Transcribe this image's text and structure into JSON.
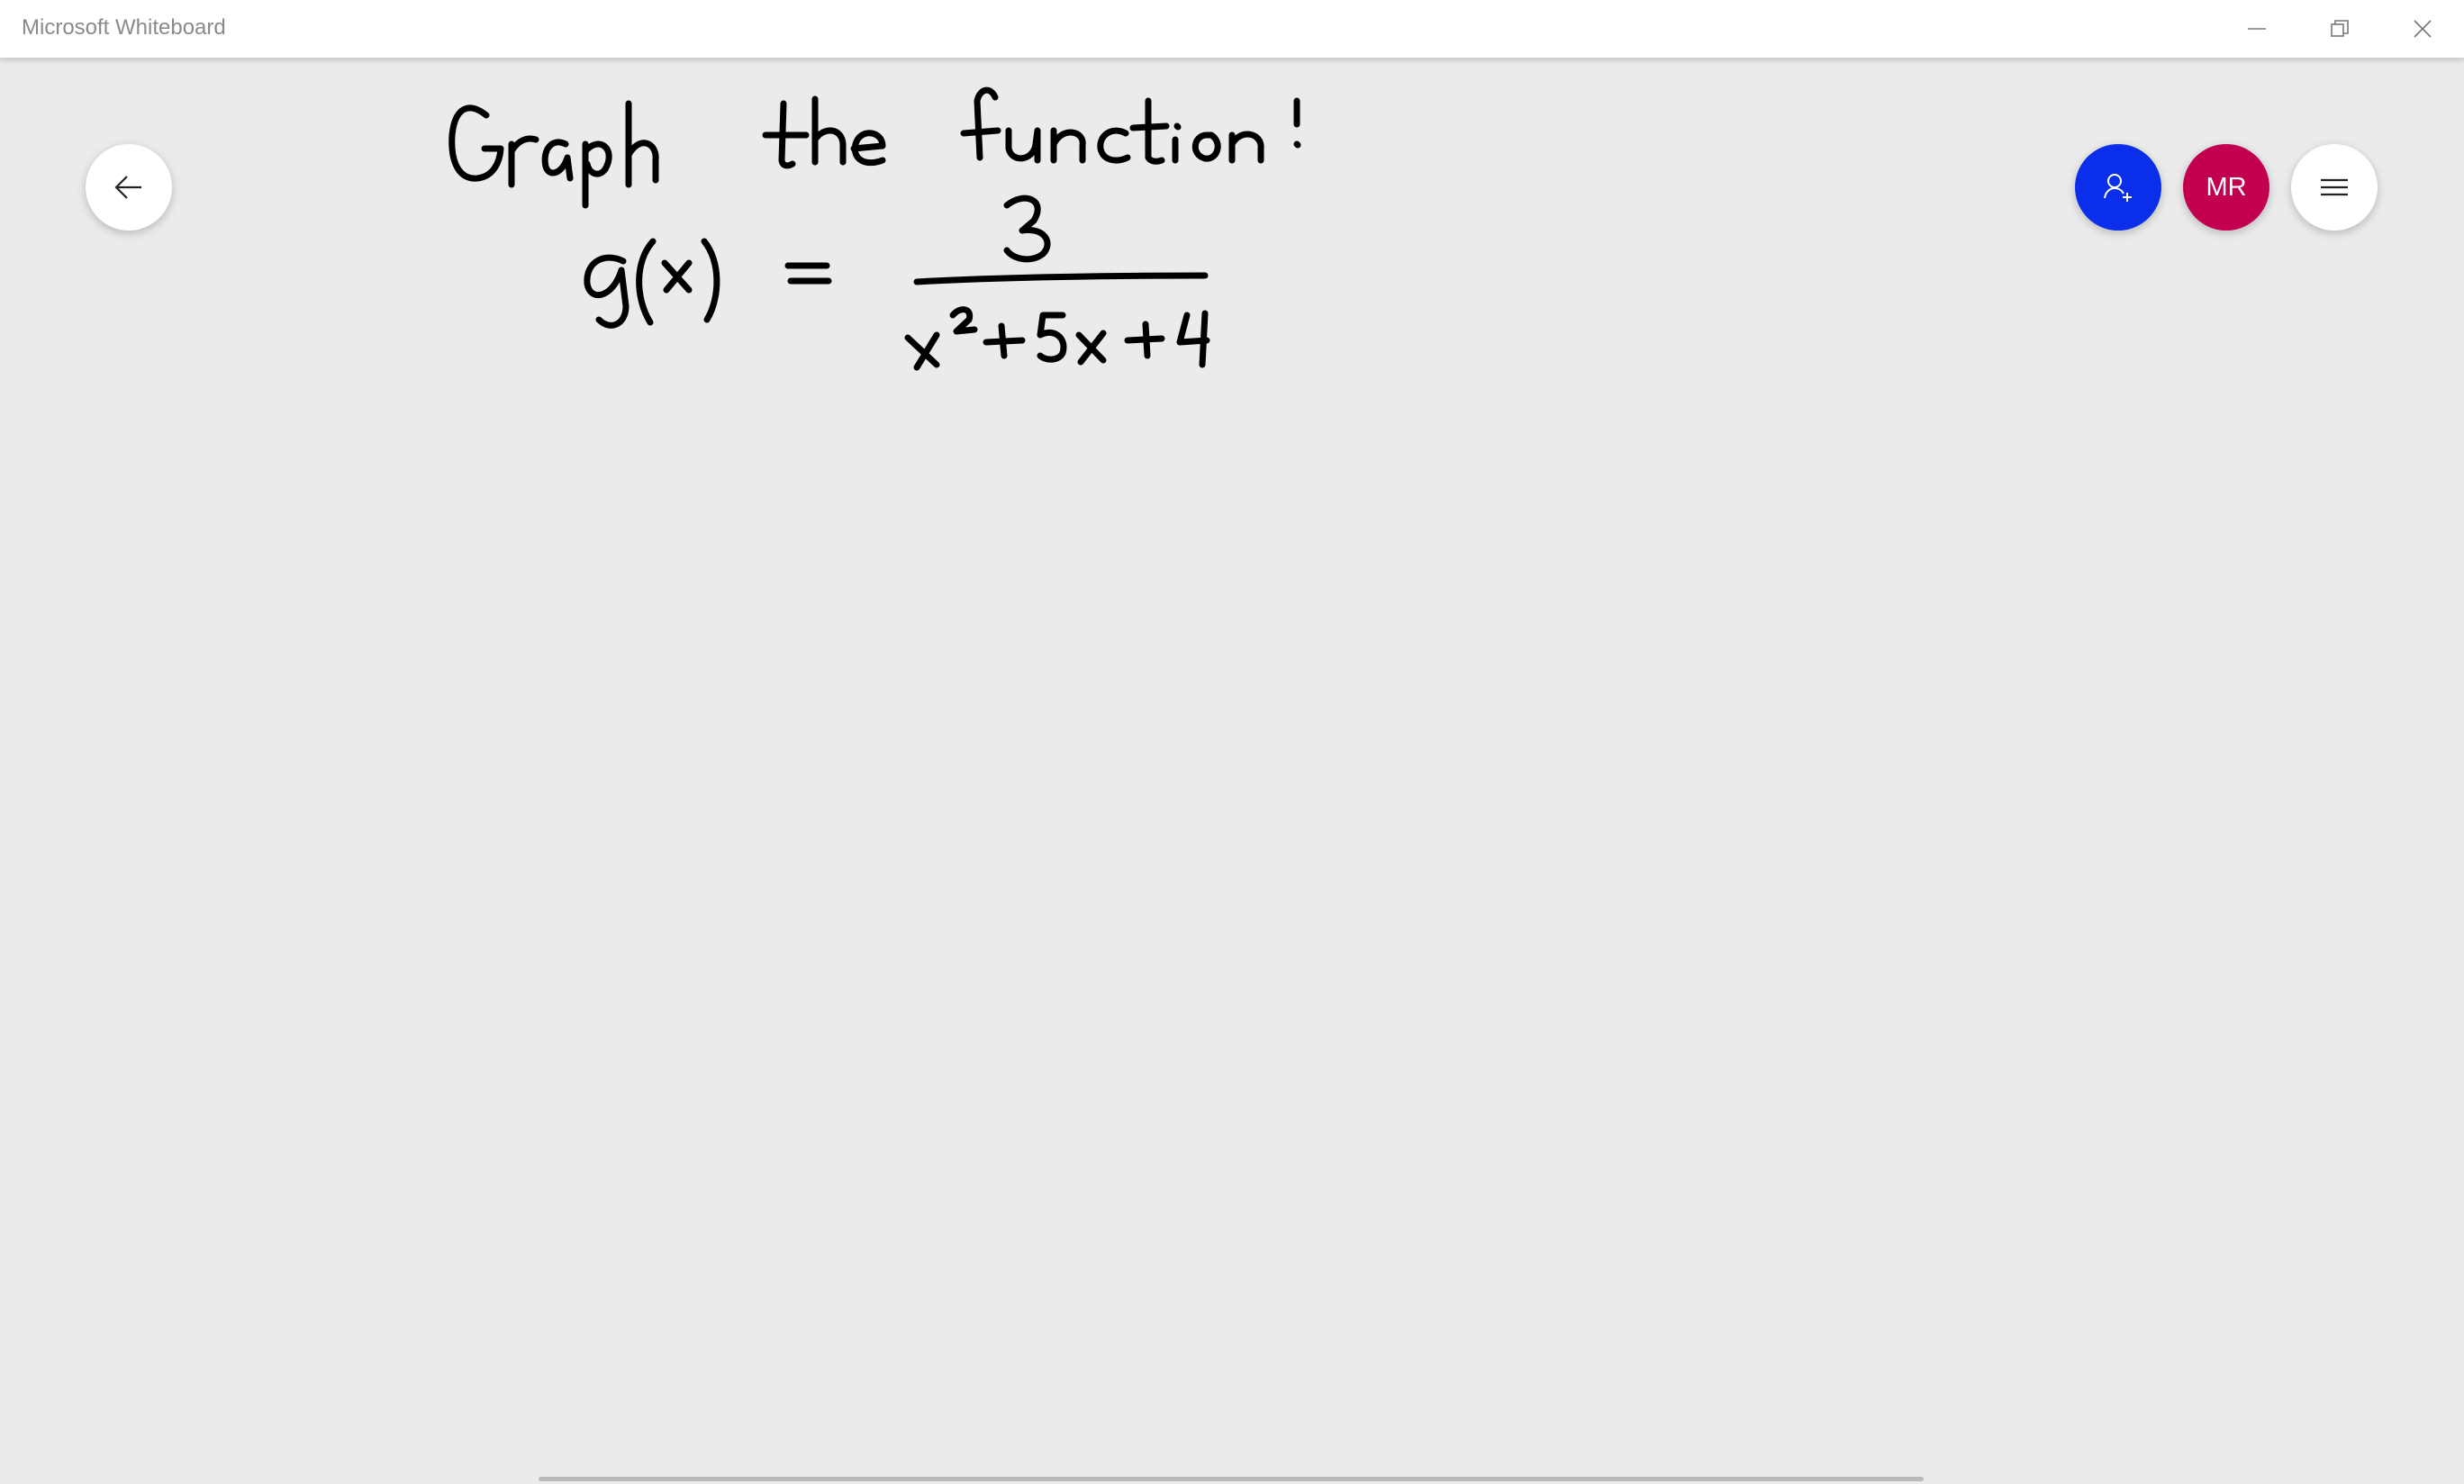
{
  "window": {
    "title": "Microsoft Whiteboard",
    "controls": [
      "minimize",
      "restore",
      "close"
    ]
  },
  "toolbar": {
    "back_icon": "arrow-left-icon",
    "invite_icon": "person-add-icon",
    "avatar_initials": "MR",
    "menu_icon": "hamburger-icon"
  },
  "colors": {
    "canvas_background": "#ebebeb",
    "invite_button": "#0a2ee9",
    "avatar": "#c3004f",
    "ink": "#000000"
  },
  "board": {
    "handwriting": {
      "heading": "Graph the function:",
      "equation_lhs": "g(x) =",
      "numerator": "3",
      "denominator": "x^2+5x+4"
    }
  }
}
